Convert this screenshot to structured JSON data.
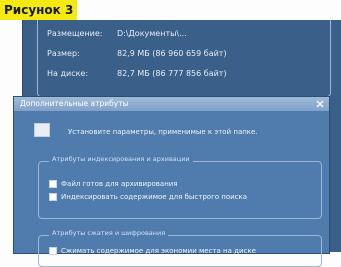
{
  "caption": "Рисунок 3",
  "properties": {
    "rows": [
      {
        "label": "Размещение:",
        "value": "D:\\Документы\\..."
      },
      {
        "label": "Размер:",
        "value": "82,9 МБ (86 960 659 байт)"
      },
      {
        "label": "На диске:",
        "value": "82,7 МБ (86 777 856 байт)"
      }
    ]
  },
  "dialog": {
    "title": "Дополнительные атрибуты",
    "compress_label": "Установите параметры, применимые к этой папке.",
    "archive_group": {
      "title": "Атрибуты индексирования и архивации",
      "options": [
        {
          "label": "Файл готов для архивирования",
          "checked": true
        },
        {
          "label": "Индексировать содержимое для быстрого поиска",
          "checked": true
        }
      ]
    },
    "compress_group": {
      "title": "Атрибуты сжатия и шифрования",
      "options": [
        {
          "label": "Сжимать содержимое для экономии места на диске",
          "checked": false
        }
      ]
    }
  }
}
